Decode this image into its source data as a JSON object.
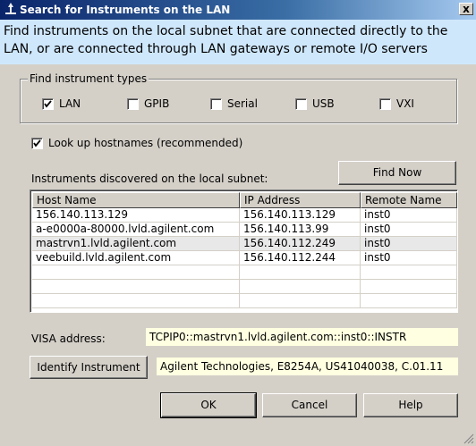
{
  "window": {
    "title": "Search for Instruments on the LAN",
    "close_glyph": "x"
  },
  "banner": {
    "line1": "Find instruments on the local subnet that are connected directly to the",
    "line2": "LAN, or are connected through LAN gateways or remote I/O servers"
  },
  "types": {
    "legend": "Find instrument types",
    "items": [
      {
        "label": "LAN",
        "checked": true
      },
      {
        "label": "GPIB",
        "checked": false
      },
      {
        "label": "Serial",
        "checked": false
      },
      {
        "label": "USB",
        "checked": false
      },
      {
        "label": "VXI",
        "checked": false
      }
    ]
  },
  "lookup": {
    "label": "Look up hostnames (recommended)",
    "checked": true
  },
  "discovered_label": "Instruments discovered on the local subnet:",
  "find_now_label": "Find Now",
  "table": {
    "columns": [
      "Host Name",
      "IP Address",
      "Remote Name"
    ],
    "rows": [
      [
        "156.140.113.129",
        "156.140.113.129",
        "inst0"
      ],
      [
        "a-e0000a-80000.lvld.agilent.com",
        "156.140.113.99",
        "inst0"
      ],
      [
        "mastrvn1.lvld.agilent.com",
        "156.140.112.249",
        "inst0"
      ],
      [
        "veebuild.lvld.agilent.com",
        "156.140.112.244",
        "inst0"
      ]
    ],
    "selected_row": 2
  },
  "visa": {
    "label": "VISA address:",
    "value": "TCPIP0::mastrvn1.lvld.agilent.com::inst0::INSTR"
  },
  "identify": {
    "button_label": "Identify Instrument",
    "result": "Agilent Technologies, E8254A, US41040038, C.01.11"
  },
  "buttons": {
    "ok": "OK",
    "cancel": "Cancel",
    "help": "Help"
  },
  "colors": {
    "banner_bg": "#cfe7fb",
    "field_bg": "#ffffe1",
    "title_start": "#0a246a",
    "title_end": "#a6caf0"
  }
}
